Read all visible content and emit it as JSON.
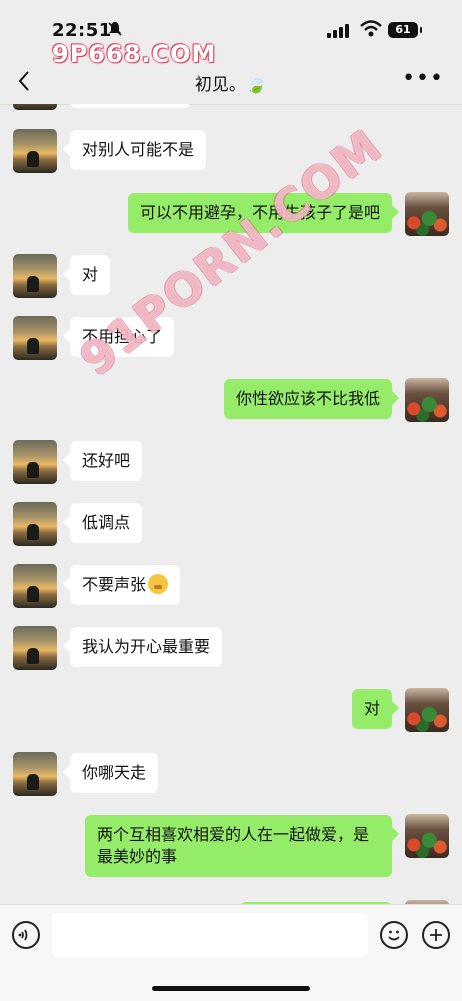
{
  "status_bar": {
    "time": "22:51",
    "battery": "61"
  },
  "watermarks": {
    "top": "9P668.COM",
    "middle": "91PORN.COM"
  },
  "header": {
    "title": "初见。🍃",
    "more": "•••"
  },
  "messages": [
    {
      "side": "in",
      "text": "对别人可能不是"
    },
    {
      "side": "out",
      "text": "可以不用避孕，不用生孩子了是吧"
    },
    {
      "side": "in",
      "text": "对"
    },
    {
      "side": "in",
      "text": "不用担心了"
    },
    {
      "side": "out",
      "text": "你性欲应该不比我低"
    },
    {
      "side": "in",
      "text": "还好吧"
    },
    {
      "side": "in",
      "text": "低调点"
    },
    {
      "side": "in",
      "text": "不要声张",
      "emoji": "shushing-face"
    },
    {
      "side": "in",
      "text": "我认为开心最重要"
    },
    {
      "side": "out",
      "text": "对"
    },
    {
      "side": "in",
      "text": "你哪天走"
    },
    {
      "side": "out",
      "text": "两个互相喜欢相爱的人在一起做爱，是最美妙的事"
    }
  ],
  "input": {
    "value": "",
    "placeholder": ""
  },
  "icons": {
    "voice": "voice-icon",
    "emoji": "emoji-icon",
    "plus": "plus-icon",
    "back": "back-chevron-icon",
    "mute": "bell-muted-icon"
  },
  "colors": {
    "background": "#ededed",
    "outgoing_bubble": "#95ec69",
    "incoming_bubble": "#ffffff"
  }
}
